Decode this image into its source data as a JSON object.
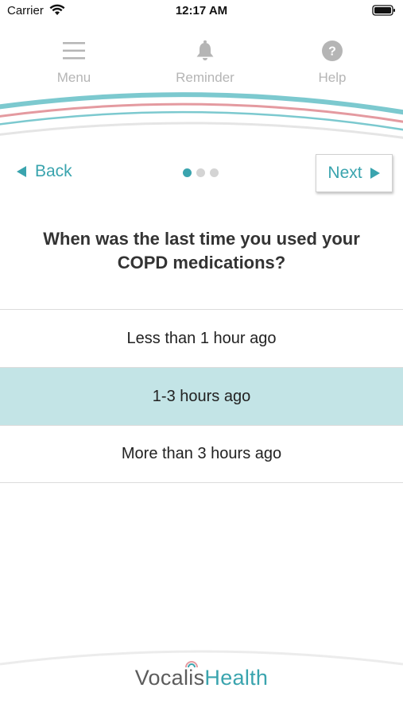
{
  "status": {
    "carrier": "Carrier",
    "time": "12:17 AM"
  },
  "nav": {
    "menu_label": "Menu",
    "reminder_label": "Reminder",
    "help_label": "Help"
  },
  "pager": {
    "back_label": "Back",
    "next_label": "Next",
    "total_pages": 3,
    "current_page": 1
  },
  "question": "When was the last time you used your COPD medications?",
  "options": [
    {
      "label": "Less than 1 hour ago",
      "selected": false
    },
    {
      "label": "1-3 hours ago",
      "selected": true
    },
    {
      "label": "More than 3 hours ago",
      "selected": false
    }
  ],
  "brand": {
    "part1": "Vocal",
    "part2": "is",
    "part3": "Health"
  },
  "colors": {
    "accent": "#3aa4ae",
    "selected_row": "#c3e4e6",
    "arc_teal": "#7cc9cf",
    "arc_pink": "#e49aa0",
    "nav_gray": "#b5b5b5"
  },
  "icons": {
    "menu": "hamburger-icon",
    "reminder": "bell-icon",
    "help": "question-circle-icon",
    "back": "triangle-left-icon",
    "next": "triangle-right-icon"
  }
}
